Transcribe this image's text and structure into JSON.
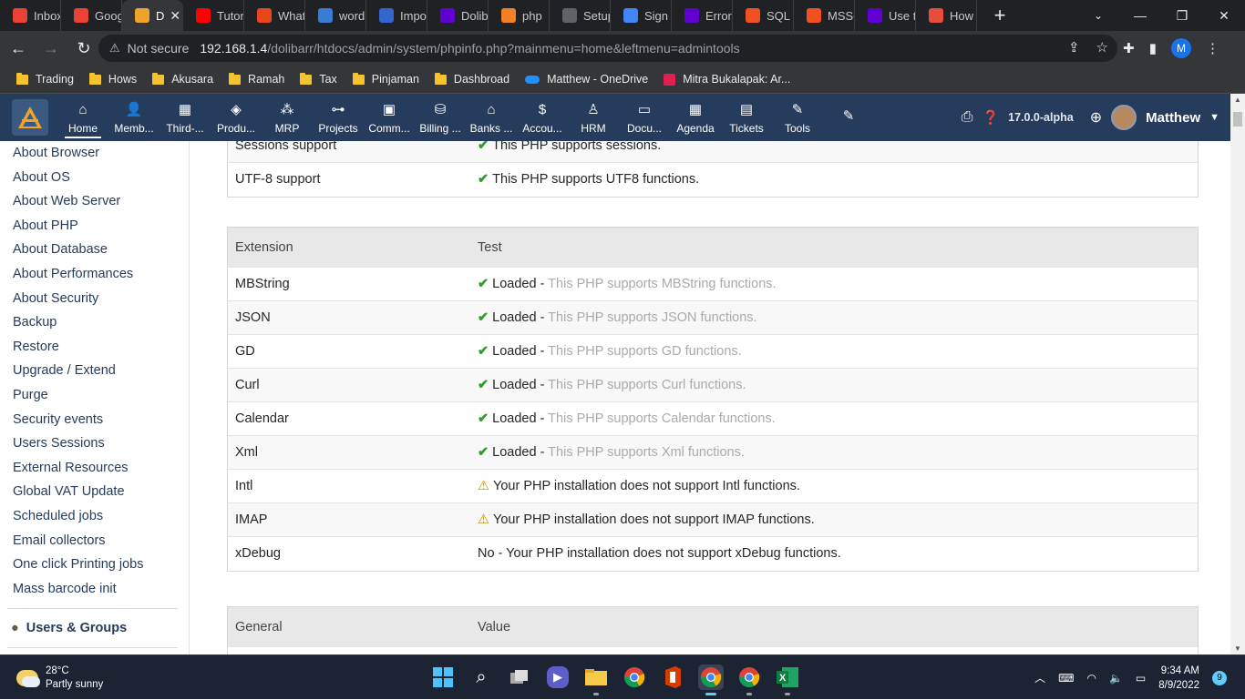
{
  "browser": {
    "tabs": [
      {
        "label": "Inbox",
        "icon": "gmail-icon",
        "color": "#ea4335"
      },
      {
        "label": "Goog",
        "icon": "gmail-icon",
        "color": "#ea4335"
      },
      {
        "label": "D",
        "icon": "dolibarr-icon",
        "color": "#f0a32b",
        "active": true
      },
      {
        "label": "Tutor",
        "icon": "youtube-icon",
        "color": "#ff0000"
      },
      {
        "label": "What",
        "icon": "stackexchange-icon",
        "color": "#e8461c"
      },
      {
        "label": "word",
        "icon": "wordpress-icon",
        "color": "#3a7bd5"
      },
      {
        "label": "Impo",
        "icon": "dolibarr-d-icon",
        "color": "#3366cc"
      },
      {
        "label": "Dolib",
        "icon": "yahoo-icon",
        "color": "#6001d2"
      },
      {
        "label": "php",
        "icon": "stackoverflow-icon",
        "color": "#f48024"
      },
      {
        "label": "Setup",
        "icon": "globe-icon",
        "color": "#5f6368"
      },
      {
        "label": "Sign",
        "icon": "google-icon",
        "color": "#4285f4"
      },
      {
        "label": "Error",
        "icon": "yahoo-icon",
        "color": "#6001d2"
      },
      {
        "label": "SQL S",
        "icon": "microsoft-icon",
        "color": "#f25022"
      },
      {
        "label": "MSSQ",
        "icon": "microsoft-icon",
        "color": "#f25022"
      },
      {
        "label": "Use t",
        "icon": "yahoo-icon",
        "color": "#6001d2"
      },
      {
        "label": "How",
        "icon": "dolibarr-icon",
        "color": "#e84c3d"
      }
    ],
    "not_secure": "Not secure",
    "url_host": "192.168.1.4",
    "url_path": "/dolibarr/htdocs/admin/system/phpinfo.php?mainmenu=home&leftmenu=admintools",
    "profile_letter": "M",
    "bookmarks": [
      {
        "label": "Trading",
        "type": "folder"
      },
      {
        "label": "Hows",
        "type": "folder"
      },
      {
        "label": "Akusara",
        "type": "folder"
      },
      {
        "label": "Ramah",
        "type": "folder"
      },
      {
        "label": "Tax",
        "type": "folder"
      },
      {
        "label": "Pinjaman",
        "type": "folder"
      },
      {
        "label": "Dashbroad",
        "type": "folder"
      },
      {
        "label": "Matthew - OneDrive",
        "type": "onedrive"
      },
      {
        "label": "Mitra Bukalapak: Ar...",
        "type": "bukalapak"
      }
    ]
  },
  "topmenu": {
    "items": [
      {
        "label": "Home",
        "icon": "home-icon",
        "glyph": "⌂",
        "selected": true
      },
      {
        "label": "Memb...",
        "icon": "member-icon",
        "glyph": "👤"
      },
      {
        "label": "Third-...",
        "icon": "building-icon",
        "glyph": "▦"
      },
      {
        "label": "Produ...",
        "icon": "cube-icon",
        "glyph": "◈"
      },
      {
        "label": "MRP",
        "icon": "cubes-icon",
        "glyph": "⁂"
      },
      {
        "label": "Projects",
        "icon": "sitemap-icon",
        "glyph": "⊶"
      },
      {
        "label": "Comm...",
        "icon": "suitcase-icon",
        "glyph": "▣"
      },
      {
        "label": "Billing ...",
        "icon": "coins-icon",
        "glyph": "⛁"
      },
      {
        "label": "Banks ...",
        "icon": "bank-icon",
        "glyph": "⌂"
      },
      {
        "label": "Accou...",
        "icon": "search-dollar-icon",
        "glyph": "$"
      },
      {
        "label": "HRM",
        "icon": "user-tie-icon",
        "glyph": "♙"
      },
      {
        "label": "Docu...",
        "icon": "folder-open-icon",
        "glyph": "▭"
      },
      {
        "label": "Agenda",
        "icon": "calendar-icon",
        "glyph": "▦"
      },
      {
        "label": "Tickets",
        "icon": "ticket-icon",
        "glyph": "▤"
      },
      {
        "label": "Tools",
        "icon": "wrench-icon",
        "glyph": "✎"
      },
      {
        "label": "",
        "icon": "edit-icon",
        "glyph": "✎"
      }
    ],
    "version": "17.0.0-alpha",
    "user": "Matthew"
  },
  "sidebar": {
    "items": [
      "About Browser",
      "About OS",
      "About Web Server",
      "About PHP",
      "About Database",
      "About Performances",
      "About Security",
      "Backup",
      "Restore",
      "Upgrade / Extend",
      "Purge",
      "Security events",
      "Users Sessions",
      "External Resources",
      "Global VAT Update",
      "Scheduled jobs",
      "Email collectors",
      "One click Printing jobs",
      "Mass barcode init"
    ],
    "group": "Users & Groups"
  },
  "main": {
    "top_rows": [
      {
        "name": "Sessions support",
        "status": "ok",
        "text": "This PHP supports sessions."
      },
      {
        "name": "UTF-8 support",
        "status": "ok",
        "text": "This PHP supports UTF8 functions."
      }
    ],
    "ext_header": {
      "col1": "Extension",
      "col2": "Test"
    },
    "extensions": [
      {
        "name": "MBString",
        "status": "ok",
        "loaded": "Loaded",
        "text": "This PHP supports MBString functions."
      },
      {
        "name": "JSON",
        "status": "ok",
        "loaded": "Loaded",
        "text": "This PHP supports JSON functions."
      },
      {
        "name": "GD",
        "status": "ok",
        "loaded": "Loaded",
        "text": "This PHP supports GD functions."
      },
      {
        "name": "Curl",
        "status": "ok",
        "loaded": "Loaded",
        "text": "This PHP supports Curl functions."
      },
      {
        "name": "Calendar",
        "status": "ok",
        "loaded": "Loaded",
        "text": "This PHP supports Calendar functions."
      },
      {
        "name": "Xml",
        "status": "ok",
        "loaded": "Loaded",
        "text": "This PHP supports Xml functions."
      },
      {
        "name": "Intl",
        "status": "warn",
        "text": "Your PHP installation does not support Intl functions."
      },
      {
        "name": "IMAP",
        "status": "warn",
        "text": "Your PHP installation does not support IMAP functions."
      },
      {
        "name": "xDebug",
        "status": "no",
        "text": "No - Your PHP installation does not support xDebug functions."
      }
    ],
    "gen_header": {
      "col1": "General",
      "col2": "Value"
    }
  },
  "taskbar": {
    "temperature": "28°C",
    "weather": "Partly sunny",
    "time": "9:34 AM",
    "date": "8/9/2022",
    "notifications": "9"
  }
}
